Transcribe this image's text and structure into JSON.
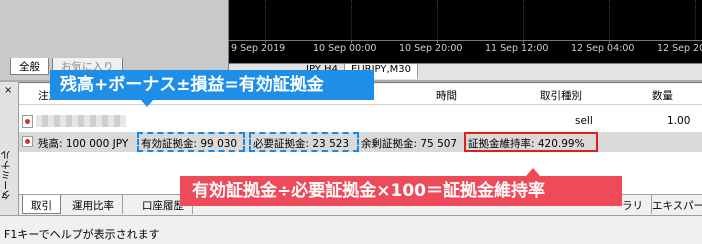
{
  "navigator": {
    "tabs": [
      {
        "label": "全般"
      },
      {
        "label": "お気に入り"
      }
    ]
  },
  "chart": {
    "background": "#000000",
    "dates": [
      "9 Sep 2019",
      "10 Sep 00:00",
      "10 Sep 20:00",
      "11 Sep 12:00",
      "12 Sep 04:00",
      "12 Sep 20:00"
    ],
    "tabs": [
      {
        "label": "JPY,H4"
      },
      {
        "label": "EURJPY,M30"
      }
    ]
  },
  "terminal": {
    "side_label": "ターミナル",
    "columns": {
      "order": "注文",
      "time": "時間",
      "trade_type": "取引種別",
      "quantity": "数量"
    },
    "row1": {
      "trade_type": "sell",
      "quantity": "1.00"
    },
    "summary": {
      "balance": "残高: 100 000 JPY",
      "equity": "有効証拠金: 99 030",
      "margin": "必要証拠金: 23 523",
      "free_margin": "余剰証拠金: 75 507",
      "margin_level": "証拠金維持率: 420.99%"
    },
    "bottom_tabs": [
      {
        "label": "取引"
      },
      {
        "label": "運用比率"
      },
      {
        "label": "口座履歴"
      },
      {
        "label": "ラリ"
      },
      {
        "label": "エキスパー"
      }
    ]
  },
  "status_bar": {
    "text": "F1キーでヘルプが表示されます"
  },
  "callouts": {
    "equity_formula": "残高+ボーナス±損益=有効証拠金",
    "margin_level_formula": "有効証拠金÷必要証拠金×100＝証拠金維持率"
  },
  "colors": {
    "blue_callout": "#1e8ee6",
    "red_callout": "#ef4a5a",
    "red_box": "#e0201a"
  }
}
